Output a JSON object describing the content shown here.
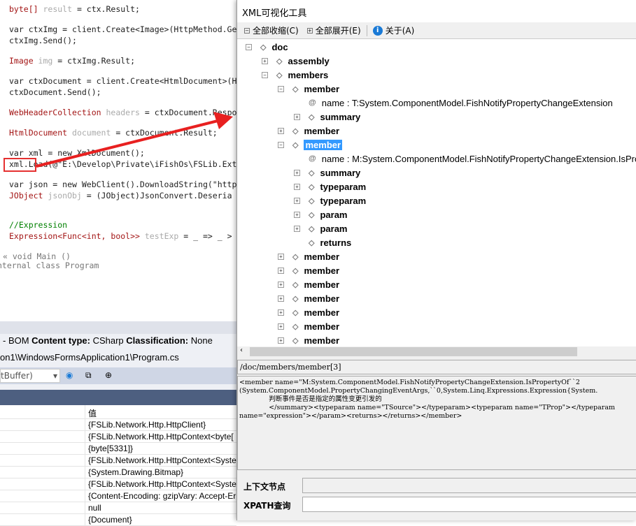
{
  "editor": {
    "lines": [
      [
        "byte[] ",
        "result",
        " = ctx.Result;"
      ],
      [
        "var ctxImg = client.Create<Image>(HttpMethod.Ge"
      ],
      [
        "ctxImg.Send();"
      ],
      [
        "Image ",
        "img",
        " = ctxImg.Result;"
      ],
      [
        "var ctxDocument = client.Create<HtmlDocument>(H"
      ],
      [
        "ctxDocument.Send();"
      ],
      [
        "WebHeaderCollection ",
        "headers",
        " = ctxDocument.Respo"
      ],
      [
        "HtmlDocument ",
        "document",
        " = ctxDocument.Result;"
      ],
      [
        "var xml = new XmlDocument();"
      ],
      [
        "xml.Load(@\"E:\\Develop\\Private\\iFishOs\\FSLib.Ext"
      ],
      [
        "var json = new WebClient().DownloadString(\"http"
      ],
      [
        "JObject ",
        "jsonObj",
        " = (JObject)JsonConvert.Deseria"
      ],
      [
        "//Expression"
      ],
      [
        "Expression<Func<int, bool>> ",
        "testExp",
        " = _ => _ >"
      ],
      [
        "« void Main ()"
      ],
      [
        "nternal class Program"
      ]
    ]
  },
  "bottom": {
    "status": [
      " - BOM ",
      "Content type:",
      " CSharp ",
      "Classification:",
      " None"
    ],
    "file_path": "on1\\WindowsFormsApplication1\\Program.cs",
    "combo": "tBuffer)",
    "value_header": "值",
    "values": [
      "{FSLib.Network.Http.HttpClient}",
      "{FSLib.Network.Http.HttpContext<byte[",
      "{byte[5331]}",
      "{FSLib.Network.Http.HttpContext<Syste",
      "{System.Drawing.Bitmap}",
      "{FSLib.Network.Http.HttpContext<Syste",
      "{Content-Encoding: gzipVary: Accept-Er",
      "null",
      "{Document}"
    ]
  },
  "xml": {
    "title": "XML可视化工具",
    "toolbar": {
      "collapse": "全部收缩(C)",
      "expand": "全部展开(E)",
      "about": "关于(A)"
    },
    "tree": [
      {
        "level": 0,
        "exp": "-",
        "label": "doc"
      },
      {
        "level": 1,
        "exp": "+",
        "label": "assembly"
      },
      {
        "level": 1,
        "exp": "-",
        "label": "members"
      },
      {
        "level": 2,
        "exp": "-",
        "label": "member"
      },
      {
        "level": 3,
        "attr": true,
        "label": "name : T:System.ComponentModel.FishNotifyPropertyChangeExtension"
      },
      {
        "level": 3,
        "exp": "+",
        "label": "summary"
      },
      {
        "level": 2,
        "exp": "+",
        "label": "member"
      },
      {
        "level": 2,
        "exp": "-",
        "label": "member",
        "selected": true
      },
      {
        "level": 3,
        "attr": true,
        "label": "name : M:System.ComponentModel.FishNotifyPropertyChangeExtension.IsPro"
      },
      {
        "level": 3,
        "exp": "+",
        "label": "summary"
      },
      {
        "level": 3,
        "exp": "+",
        "label": "typeparam"
      },
      {
        "level": 3,
        "exp": "+",
        "label": "typeparam"
      },
      {
        "level": 3,
        "exp": "+",
        "label": "param"
      },
      {
        "level": 3,
        "exp": "+",
        "label": "param"
      },
      {
        "level": 3,
        "label": "returns"
      },
      {
        "level": 2,
        "exp": "+",
        "label": "member"
      },
      {
        "level": 2,
        "exp": "+",
        "label": "member"
      },
      {
        "level": 2,
        "exp": "+",
        "label": "member"
      },
      {
        "level": 2,
        "exp": "+",
        "label": "member"
      },
      {
        "level": 2,
        "exp": "+",
        "label": "member"
      },
      {
        "level": 2,
        "exp": "+",
        "label": "member"
      },
      {
        "level": 2,
        "exp": "+",
        "label": "member"
      }
    ],
    "path": "/doc/members/member[3]",
    "detail": "<member name=\"M:System.ComponentModel.FishNotifyPropertyChangeExtension.IsPropertyOf``2\n(System.ComponentModel.PropertyChangingEventArgs,``0,System.Linq.Expressions.Expression{System.\n              判断事件是否是指定的属性变更引发的\n              </summary><typeparam name=\"TSource\"></typeparam><typeparam name=\"TProp\"></typeparam\nname=\"expression\"></param><returns></returns></member>",
    "context_label": "上下文节点",
    "context_value": "",
    "xpath_label": "XPATH查询",
    "xpath_value": ""
  }
}
